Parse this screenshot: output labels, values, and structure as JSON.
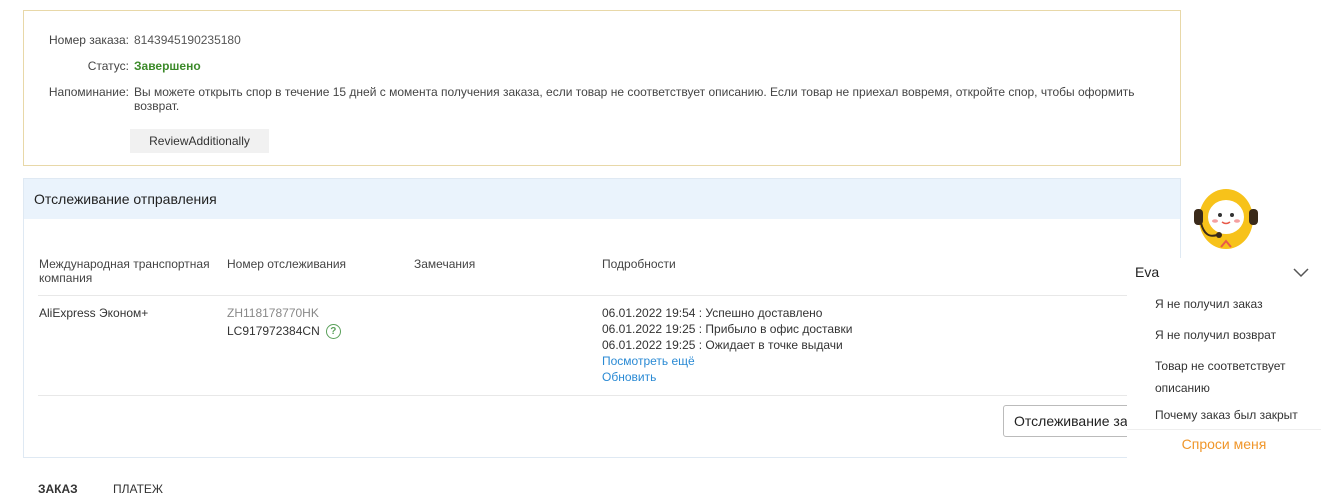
{
  "order": {
    "number_label": "Номер заказа:",
    "number_value": "8143945190235180",
    "status_label": "Статус:",
    "status_value": "Завершено",
    "reminder_label": "Напоминание:",
    "reminder_text": "Вы можете открыть спор в течение 15 дней с момента получения заказа, если товар не соответствует описанию. Если товар не приехал вовремя, откройте спор, чтобы оформить возврат.",
    "review_button": "ReviewAdditionally"
  },
  "tracking": {
    "title": "Отслеживание отправления",
    "columns": {
      "carrier": "Международная транспортная компания",
      "number": "Номер отслеживания",
      "remarks": "Замечания",
      "details": "Подробности"
    },
    "row": {
      "carrier": "AliExpress Эконом+",
      "tracking_number_1": "ZH118178770HK",
      "tracking_number_2": "LC917972384CN",
      "events": [
        "06.01.2022 19:54 : Успешно доставлено",
        "06.01.2022 19:25 : Прибыло в офис доставки",
        "06.01.2022 19:25 : Ожидает в точке выдачи"
      ],
      "see_more": "Посмотреть ещё",
      "refresh": "Обновить"
    },
    "track_button": "Отслеживание заказа"
  },
  "tabs": [
    "ЗАКАЗ",
    "ПЛАТЕЖ"
  ],
  "assistant": {
    "name": "Eva",
    "items": [
      "Я не получил заказ",
      "Я не получил возврат",
      "Товар не соответствует описанию",
      "Почему заказ был закрыт"
    ],
    "ask_label": "Спроси меня",
    "accent_color": "#f0962a"
  },
  "colors": {
    "status_green": "#3c8a2a",
    "link_blue": "#2a8ad4",
    "header_bg": "#eaf3fc",
    "order_border": "#e8d8a8"
  }
}
